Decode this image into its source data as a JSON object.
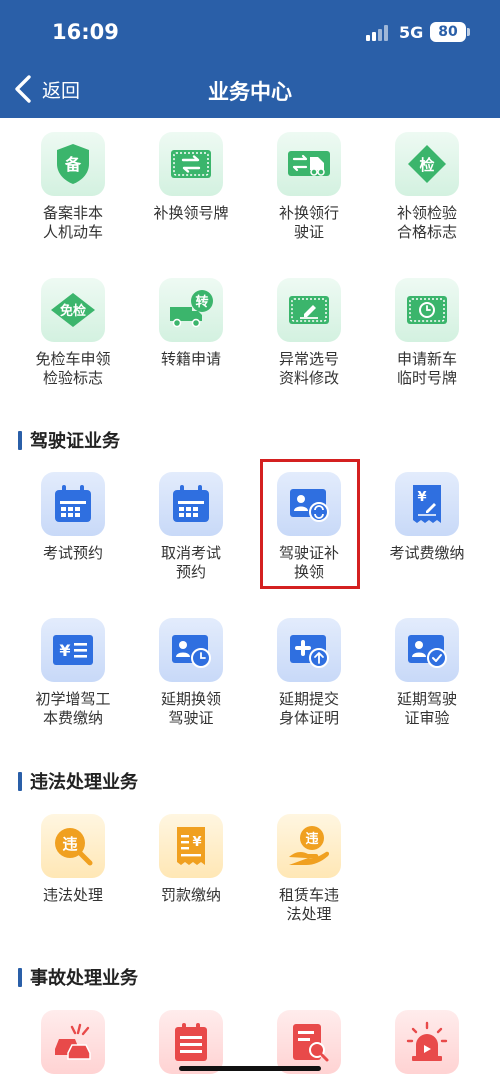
{
  "status_bar": {
    "time": "16:09",
    "network": "5G",
    "battery": "80"
  },
  "nav": {
    "back_label": "返回",
    "title": "业务中心"
  },
  "sections": {
    "license": "驾驶证业务",
    "violation": "违法处理业务",
    "accident": "事故处理业务"
  },
  "vehicle_items": [
    {
      "label": "备案非本\n人机动车",
      "icon": "shield-icon"
    },
    {
      "label": "补换领号牌",
      "icon": "license-plate-swap-icon"
    },
    {
      "label": "补换领行\n驶证",
      "icon": "truck-swap-icon"
    },
    {
      "label": "补领检验\n合格标志",
      "icon": "inspection-diamond-icon"
    },
    {
      "label": "免检车申领\n检验标志",
      "icon": "exempt-diamond-icon"
    },
    {
      "label": "转籍申请",
      "icon": "truck-transfer-icon"
    },
    {
      "label": "异常选号\n资料修改",
      "icon": "plate-edit-icon"
    },
    {
      "label": "申请新车\n临时号牌",
      "icon": "plate-clock-icon"
    }
  ],
  "license_items": [
    {
      "label": "考试预约",
      "icon": "calendar-icon"
    },
    {
      "label": "取消考试\n预约",
      "icon": "calendar-icon"
    },
    {
      "label": "驾驶证补\n换领",
      "icon": "id-card-swap-icon"
    },
    {
      "label": "考试费缴纳",
      "icon": "receipt-yuan-icon"
    },
    {
      "label": "初学增驾工\n本费缴纳",
      "icon": "yuan-list-icon"
    },
    {
      "label": "延期换领\n驾驶证",
      "icon": "id-card-clock-icon"
    },
    {
      "label": "延期提交\n身体证明",
      "icon": "medical-upload-icon"
    },
    {
      "label": "延期驾驶\n证审验",
      "icon": "id-card-check-icon"
    }
  ],
  "violation_items": [
    {
      "label": "违法处理",
      "icon": "violation-search-icon"
    },
    {
      "label": "罚款缴纳",
      "icon": "fine-receipt-icon"
    },
    {
      "label": "租赁车违\n法处理",
      "icon": "hand-violation-icon"
    }
  ],
  "accident_items": [
    {
      "icon": "car-crash-icon"
    },
    {
      "icon": "accident-report-icon"
    },
    {
      "icon": "document-search-icon"
    },
    {
      "icon": "alarm-light-icon"
    }
  ],
  "glyphs": {
    "bei": "备",
    "jian": "检",
    "mianjian": "免检",
    "zhuan": "转",
    "wei": "违",
    "yuan": "¥"
  },
  "colors": {
    "header": "#2a5fa8",
    "green_icon": "#3bb56c",
    "blue_icon": "#2f6fe0",
    "orange_icon": "#f0a020",
    "red_icon": "#e84a4a",
    "highlight": "#d42020"
  }
}
